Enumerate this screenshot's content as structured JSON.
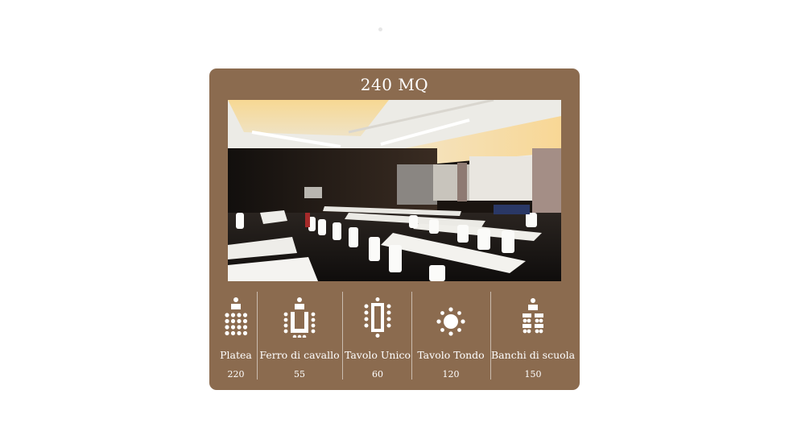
{
  "room": {
    "title": "240 MQ",
    "photo_alt": "Sala meeting con tavoli bianchi e proiettore"
  },
  "layouts": [
    {
      "label": "Platea",
      "value": "220",
      "icon": "theater-seating-icon"
    },
    {
      "label": "Ferro di cavallo",
      "value": "55",
      "icon": "u-shape-icon"
    },
    {
      "label": "Tavolo Unico",
      "value": "60",
      "icon": "boardroom-table-icon"
    },
    {
      "label": "Tavolo Tondo",
      "value": "120",
      "icon": "round-table-icon"
    },
    {
      "label": "Banchi di scuola",
      "value": "150",
      "icon": "classroom-icon"
    }
  ],
  "colors": {
    "card": "#8b6b4f",
    "text": "#ffffff"
  }
}
